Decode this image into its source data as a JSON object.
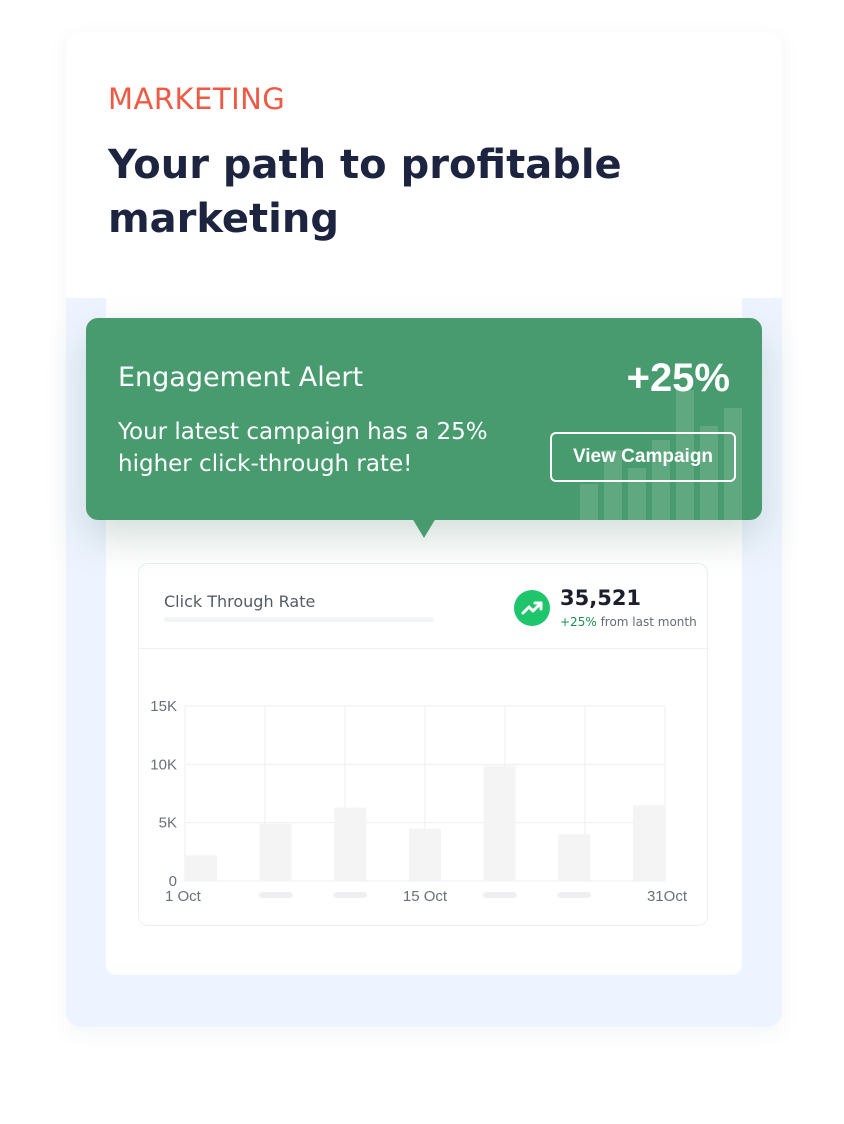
{
  "hero": {
    "eyebrow": "MARKETING",
    "headline": "Your path to profitable marketing"
  },
  "alert": {
    "title": "Engagement Alert",
    "message": "Your latest campaign has a 25% higher click-through rate!",
    "percent": "+25%",
    "button_label": "View Campaign"
  },
  "metric": {
    "label": "Click Through Rate",
    "value": "35,521",
    "change": "+25%",
    "change_suffix": "from last month",
    "icon": "trending-up-icon"
  },
  "colors": {
    "accent_red": "#ef5a44",
    "alert_green": "#489b6e",
    "positive_green": "#1ec56b",
    "bar_gray": "#f4f4f5"
  },
  "chart_data": {
    "type": "bar",
    "categories": [
      "1 Oct",
      "",
      "",
      "15 Oct",
      "",
      "",
      "31Oct"
    ],
    "values": [
      2200,
      4900,
      6300,
      4500,
      9900,
      4000,
      6500
    ],
    "y_ticks": [
      "0",
      "5K",
      "10K",
      "15K"
    ],
    "y_tick_values": [
      0,
      5000,
      10000,
      15000
    ],
    "ylim": [
      0,
      15000
    ],
    "grid": true
  }
}
